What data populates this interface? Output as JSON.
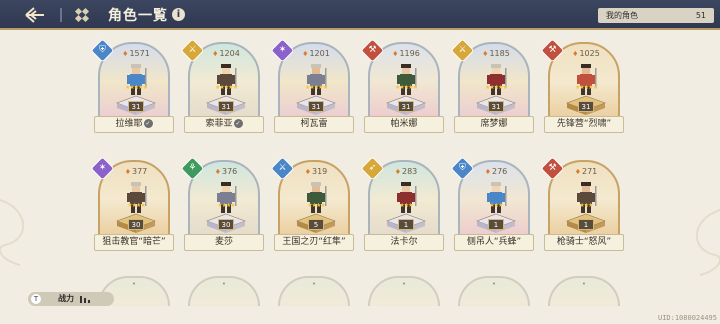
{
  "header": {
    "back_icon": "back-arrow-icon",
    "menu_icon": "grid-menu-icon",
    "title": "角色一覧",
    "info_label": "i"
  },
  "my_roles": {
    "label": "我的角色",
    "count": "51"
  },
  "characters": [
    {
      "name": "拉维耶",
      "power": "1571",
      "level": "31",
      "stars": 5,
      "class_icon": "tank-shield-icon",
      "class_color": "#4a86c8",
      "theme": "tpurple",
      "verified": true
    },
    {
      "name": "索菲亚",
      "power": "1204",
      "level": "31",
      "stars": 5,
      "class_icon": "rogue-blade-icon",
      "class_color": "#d7a73a",
      "theme": "tgreen",
      "verified": true
    },
    {
      "name": "柯瓦雷",
      "power": "1201",
      "level": "31",
      "stars": 5,
      "class_icon": "mage-flame-icon",
      "class_color": "#8a62c9",
      "theme": "tpurple",
      "verified": false
    },
    {
      "name": "帕米娜",
      "power": "1196",
      "level": "31",
      "stars": 5,
      "class_icon": "warrior-axe-icon",
      "class_color": "#c2503f",
      "theme": "tpink",
      "verified": false
    },
    {
      "name": "席梦娜",
      "power": "1185",
      "level": "31",
      "stars": 5,
      "class_icon": "rogue-blade-icon",
      "class_color": "#d7a73a",
      "theme": "tpurple",
      "verified": false
    },
    {
      "name": "先锋营“烈啸”",
      "power": "1025",
      "level": "31",
      "stars": 5,
      "class_icon": "warrior-axe-icon",
      "class_color": "#c2503f",
      "theme": "tgold",
      "verified": false
    },
    {
      "name": "狙击教官“暗芒”",
      "power": "377",
      "level": "30",
      "stars": 4,
      "class_icon": "mage-flame-icon",
      "class_color": "#8a62c9",
      "theme": "tgold",
      "verified": false
    },
    {
      "name": "麦莎",
      "power": "376",
      "level": "30",
      "stars": 4,
      "class_icon": "healer-leaf-icon",
      "class_color": "#3f9a5e",
      "theme": "tgreen",
      "verified": false
    },
    {
      "name": "王国之刃“红隼”",
      "power": "319",
      "level": "5",
      "stars": 4,
      "class_icon": "rogue-blade-icon",
      "class_color": "#4a86c8",
      "theme": "tgold",
      "verified": false
    },
    {
      "name": "法卡尔",
      "power": "283",
      "level": "1",
      "stars": 3,
      "class_icon": "ranger-bow-icon",
      "class_color": "#d7a73a",
      "theme": "tgreen",
      "verified": false
    },
    {
      "name": "侧吊人“兵蜂”",
      "power": "276",
      "level": "1",
      "stars": 3,
      "class_icon": "tank-shield-icon",
      "class_color": "#4a86c8",
      "theme": "tpink",
      "verified": false
    },
    {
      "name": "枪骑士“怒风”",
      "power": "271",
      "level": "1",
      "stars": 3,
      "class_icon": "warrior-axe-icon",
      "class_color": "#c2503f",
      "theme": "tgold",
      "verified": false
    }
  ],
  "sort": {
    "icon_label": "T",
    "label": "战力",
    "icon": "bar-sort-icon"
  },
  "uid": "UID:1080024495"
}
